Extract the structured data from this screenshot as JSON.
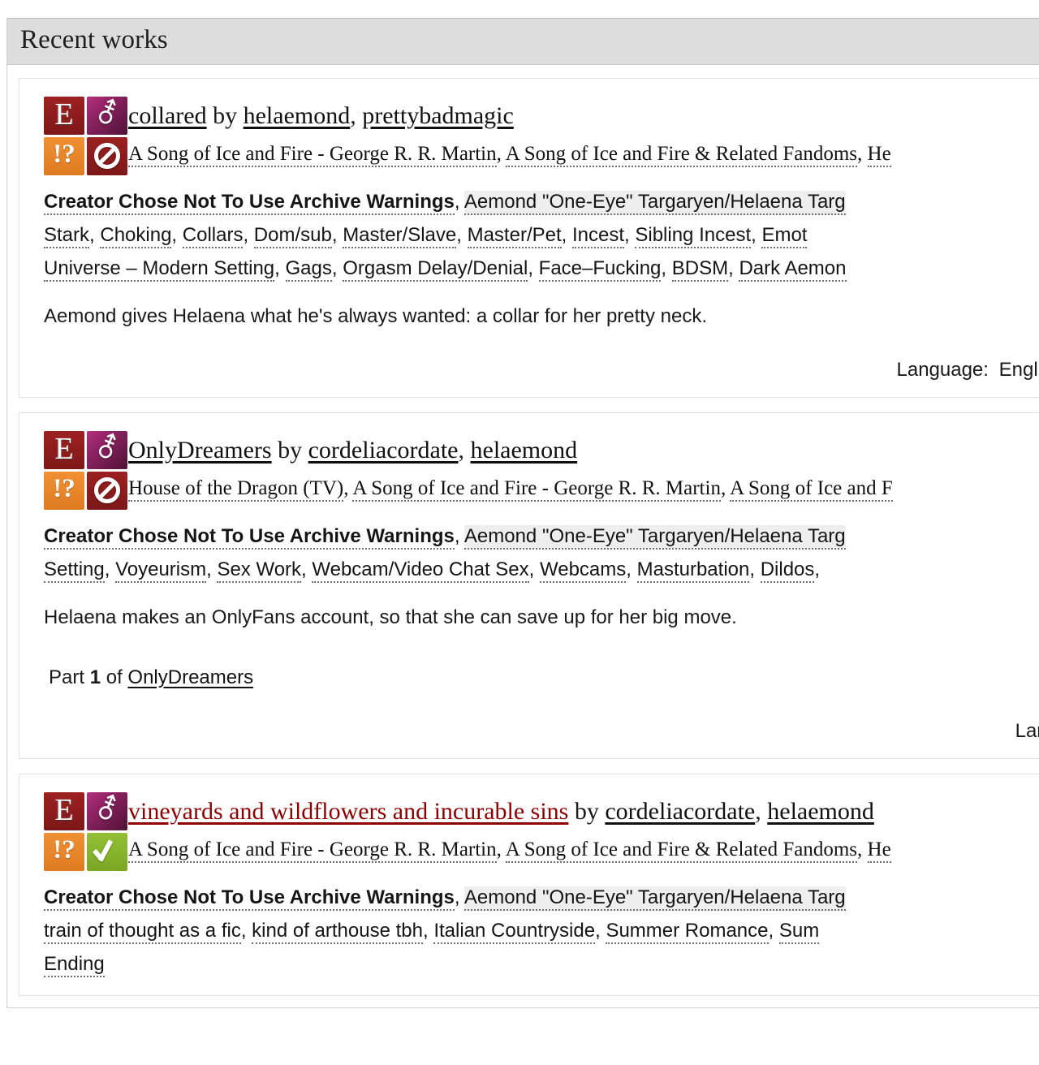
{
  "module": {
    "heading": "Recent works"
  },
  "colors": {
    "rating_explicit_bg": "#8c1c1c",
    "category_other_bg": "#8f2263",
    "warning_bg": "#e8852a",
    "complete_bg": "#86b32c",
    "visited_link": "#900000",
    "heading_bg": "#dddddd",
    "relationship_tag_bg": "#eeeeee"
  },
  "works": [
    {
      "icons": [
        {
          "name": "rating-explicit-icon",
          "title": "Explicit",
          "glyph": "E"
        },
        {
          "name": "category-other-icon",
          "title": "Multi",
          "glyph": "⚦"
        },
        {
          "name": "warning-choosenotto-icon",
          "title": "Creator Chose Not To Use Archive Warnings",
          "glyph": "!?"
        },
        {
          "name": "work-incomplete-icon",
          "title": "Incomplete",
          "glyph": ""
        }
      ],
      "title": "collared",
      "title_visited": false,
      "by": "by",
      "authors": [
        "helaemond",
        "prettybadmagic"
      ],
      "fandoms": [
        "A Song of Ice and Fire - George R. R. Martin",
        "A Song of Ice and Fire & Related Fandoms",
        "He"
      ],
      "tags": [
        {
          "text": "Creator Chose Not To Use Archive Warnings",
          "type": "warning"
        },
        {
          "text": "Aemond \"One-Eye\" Targaryen/Helaena Targ",
          "type": "relationship"
        },
        {
          "text": "Stark",
          "type": "freeform"
        },
        {
          "text": "Choking",
          "type": "freeform"
        },
        {
          "text": "Collars",
          "type": "freeform"
        },
        {
          "text": "Dom/sub",
          "type": "freeform"
        },
        {
          "text": "Master/Slave",
          "type": "freeform"
        },
        {
          "text": "Master/Pet",
          "type": "freeform"
        },
        {
          "text": "Incest",
          "type": "freeform"
        },
        {
          "text": "Sibling Incest",
          "type": "freeform"
        },
        {
          "text": "Emot",
          "type": "freeform"
        },
        {
          "text": "Universe – Modern Setting",
          "type": "freeform"
        },
        {
          "text": "Gags",
          "type": "freeform"
        },
        {
          "text": "Orgasm Delay/Denial",
          "type": "freeform"
        },
        {
          "text": "Face–Fucking",
          "type": "freeform"
        },
        {
          "text": "BDSM",
          "type": "freeform"
        },
        {
          "text": "Dark Aemon",
          "type": "freeform"
        }
      ],
      "summary": "Aemond gives Helaena what he's always wanted: a collar for her pretty neck.",
      "series": null,
      "stats": [
        {
          "label": "Language:",
          "value": "Engli"
        }
      ]
    },
    {
      "icons": [
        {
          "name": "rating-explicit-icon",
          "title": "Explicit",
          "glyph": "E"
        },
        {
          "name": "category-other-icon",
          "title": "Multi",
          "glyph": "⚦"
        },
        {
          "name": "warning-choosenotto-icon",
          "title": "Creator Chose Not To Use Archive Warnings",
          "glyph": "!?"
        },
        {
          "name": "work-incomplete-icon",
          "title": "Incomplete",
          "glyph": ""
        }
      ],
      "title": "OnlyDreamers",
      "title_visited": false,
      "by": "by",
      "authors": [
        "cordeliacordate",
        "helaemond"
      ],
      "fandoms": [
        "House of the Dragon (TV)",
        "A Song of Ice and Fire - George R. R. Martin",
        "A Song of Ice and F"
      ],
      "tags": [
        {
          "text": "Creator Chose Not To Use Archive Warnings",
          "type": "warning"
        },
        {
          "text": "Aemond \"One-Eye\" Targaryen/Helaena Targ",
          "type": "relationship"
        },
        {
          "text": "Setting",
          "type": "freeform"
        },
        {
          "text": "Voyeurism",
          "type": "freeform"
        },
        {
          "text": "Sex Work",
          "type": "freeform"
        },
        {
          "text": "Webcam/Video Chat Sex",
          "type": "freeform"
        },
        {
          "text": "Webcams",
          "type": "freeform"
        },
        {
          "text": "Masturbation",
          "type": "freeform"
        },
        {
          "text": "Dildos",
          "type": "freeform"
        }
      ],
      "summary": "Helaena makes an OnlyFans account, so that she can save up for her big move.",
      "series": {
        "part_label": "Part",
        "part_number": "1",
        "of_label": "of",
        "series_name": "OnlyDreamers"
      },
      "stats": [
        {
          "label": "Lang",
          "value": ""
        }
      ]
    },
    {
      "icons": [
        {
          "name": "rating-explicit-icon",
          "title": "Explicit",
          "glyph": "E"
        },
        {
          "name": "category-other-icon",
          "title": "Multi",
          "glyph": "⚦"
        },
        {
          "name": "warning-choosenotto-icon",
          "title": "Creator Chose Not To Use Archive Warnings",
          "glyph": "!?"
        },
        {
          "name": "work-complete-icon",
          "title": "Complete Work",
          "glyph": ""
        }
      ],
      "title": "vineyards and wildflowers and incurable sins",
      "title_visited": true,
      "by": "by",
      "authors": [
        "cordeliacordate",
        "helaemond"
      ],
      "fandoms": [
        "A Song of Ice and Fire - George R. R. Martin",
        "A Song of Ice and Fire & Related Fandoms",
        "He"
      ],
      "tags": [
        {
          "text": "Creator Chose Not To Use Archive Warnings",
          "type": "warning"
        },
        {
          "text": "Aemond \"One-Eye\" Targaryen/Helaena Targ",
          "type": "relationship"
        },
        {
          "text": "train of thought as a fic",
          "type": "freeform"
        },
        {
          "text": "kind of arthouse tbh",
          "type": "freeform"
        },
        {
          "text": "Italian Countryside",
          "type": "freeform"
        },
        {
          "text": "Summer Romance",
          "type": "freeform"
        },
        {
          "text": "Sum",
          "type": "freeform"
        },
        {
          "text": "Ending",
          "type": "freeform"
        }
      ],
      "summary": null,
      "series": null,
      "stats": []
    }
  ]
}
